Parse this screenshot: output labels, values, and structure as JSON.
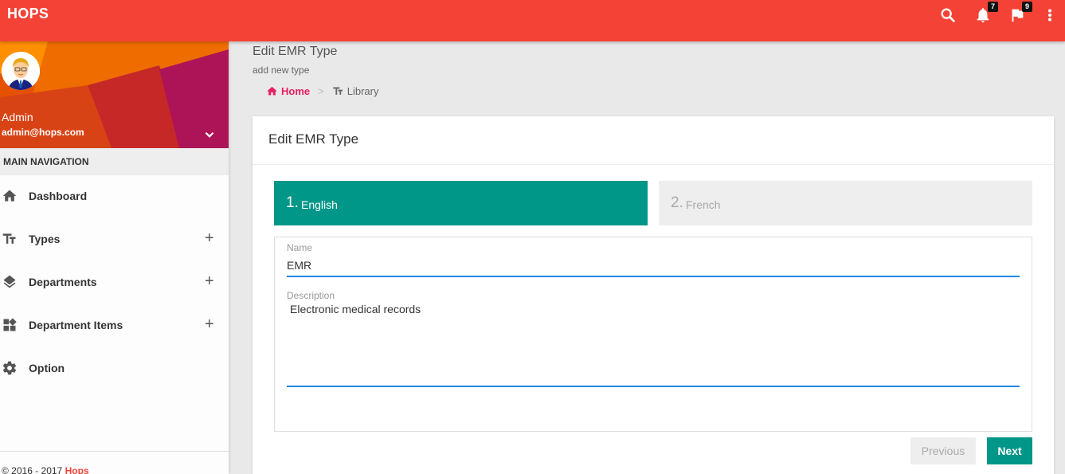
{
  "app": {
    "title": "HOPS"
  },
  "topbar": {
    "notifications_count": "7",
    "flags_count": "9"
  },
  "profile": {
    "name": "Admin",
    "email": "admin@hops.com"
  },
  "nav": {
    "header": "MAIN NAVIGATION",
    "items": [
      {
        "label": "Dashboard",
        "icon": "home-icon",
        "expandable": false
      },
      {
        "label": "Types",
        "icon": "text-type-icon",
        "expandable": true
      },
      {
        "label": "Departments",
        "icon": "layers-icon",
        "expandable": true
      },
      {
        "label": "Department Items",
        "icon": "widgets-icon",
        "expandable": true
      },
      {
        "label": "Option",
        "icon": "gear-icon",
        "expandable": false
      }
    ],
    "plus": "+"
  },
  "footer": {
    "copyright": "© 2016 - 2017",
    "brand": "Hops"
  },
  "page": {
    "title": "Edit EMR Type",
    "subtitle": "add new type"
  },
  "breadcrumb": {
    "home": "Home",
    "separator": ">",
    "library": "Library"
  },
  "card": {
    "title": "Edit EMR Type",
    "steps": [
      {
        "num": "1.",
        "label": "English",
        "active": true
      },
      {
        "num": "2.",
        "label": "French",
        "active": false
      }
    ],
    "fields": {
      "name_label": "Name",
      "name_value": "EMR",
      "description_label": "Description",
      "description_value": "Electronic medical records"
    },
    "buttons": {
      "previous": "Previous",
      "next": "Next"
    }
  },
  "colors": {
    "topbar": "#f44336",
    "accent": "#009688",
    "breadcrumb_home": "#e91e63",
    "input_underline": "#1e88e5"
  }
}
